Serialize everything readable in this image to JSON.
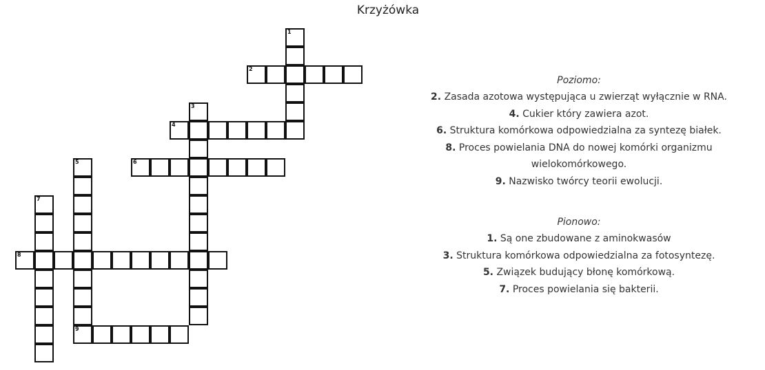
{
  "title": "Krzyżówka",
  "across_heading": "Poziomo:",
  "down_heading": "Pionowo:",
  "across": [
    {
      "num": "2.",
      "text": "Zasada azotowa występująca u zwierząt wyłącznie w RNA."
    },
    {
      "num": "4.",
      "text": "Cukier który zawiera azot."
    },
    {
      "num": "6.",
      "text": "Struktura komórkowa odpowiedzialna za syntezę białek."
    },
    {
      "num": "8.",
      "text": "Proces powielania DNA do nowej komórki organizmu wielokomórkowego."
    },
    {
      "num": "9.",
      "text": "Nazwisko twórcy teorii ewolucji."
    }
  ],
  "down": [
    {
      "num": "1.",
      "text": "Są one zbudowane z aminokwasów"
    },
    {
      "num": "3.",
      "text": "Struktura komórkowa odpowiedzialna za fotosyntezę."
    },
    {
      "num": "5.",
      "text": "Związek budujący błonę komórkową."
    },
    {
      "num": "7.",
      "text": "Proces powielania się bakterii."
    }
  ],
  "grid_numbers": [
    "1",
    "2",
    "3",
    "4",
    "5",
    "6",
    "7",
    "8",
    "9"
  ]
}
